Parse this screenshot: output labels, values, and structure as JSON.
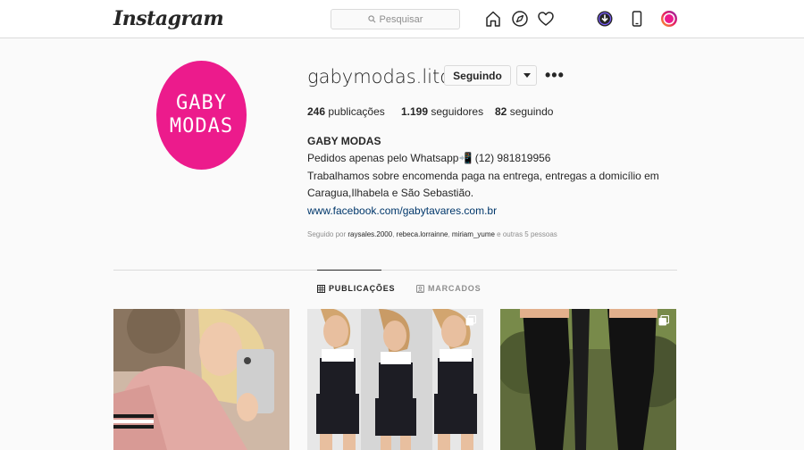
{
  "header": {
    "logo": "Instagram",
    "search_placeholder": "Pesquisar",
    "icons": [
      "home-icon",
      "compass-icon",
      "heart-icon",
      "download-extension-icon",
      "mobile-icon",
      "profile-avatar-icon"
    ]
  },
  "profile": {
    "avatar_line1": "GABY",
    "avatar_line2": "MODAS",
    "username": "gabymodas.litoral",
    "follow_label": "Seguindo",
    "more_label": "•••",
    "stats": {
      "posts_count": "246",
      "posts_label": "publicações",
      "followers_count": "1.199",
      "followers_label": "seguidores",
      "following_count": "82",
      "following_label": "seguindo"
    },
    "bio": {
      "name": "GABY MODAS",
      "line1": "Pedidos apenas pelo Whatsapp📲 (12) 981819956",
      "line2": "Trabalhamos sobre encomenda paga na entrega, entregas a domicílio em",
      "line3": "Caragua,Ilhabela e São Sebastião.",
      "link": "www.facebook.com/gabytavares.com.br"
    },
    "followed_by": {
      "prefix": "Seguido por",
      "user1": "raysales.2000",
      "user2": "rebeca.lorrainne",
      "user3": "miriam_yume",
      "suffix": "e outras 5 pessoas"
    }
  },
  "tabs": {
    "posts": "PUBLICAÇÕES",
    "tagged": "MARCADOS"
  },
  "colors": {
    "brand_pink": "#ec1b8c",
    "link": "#00376b",
    "muted": "#8e8e8e"
  }
}
